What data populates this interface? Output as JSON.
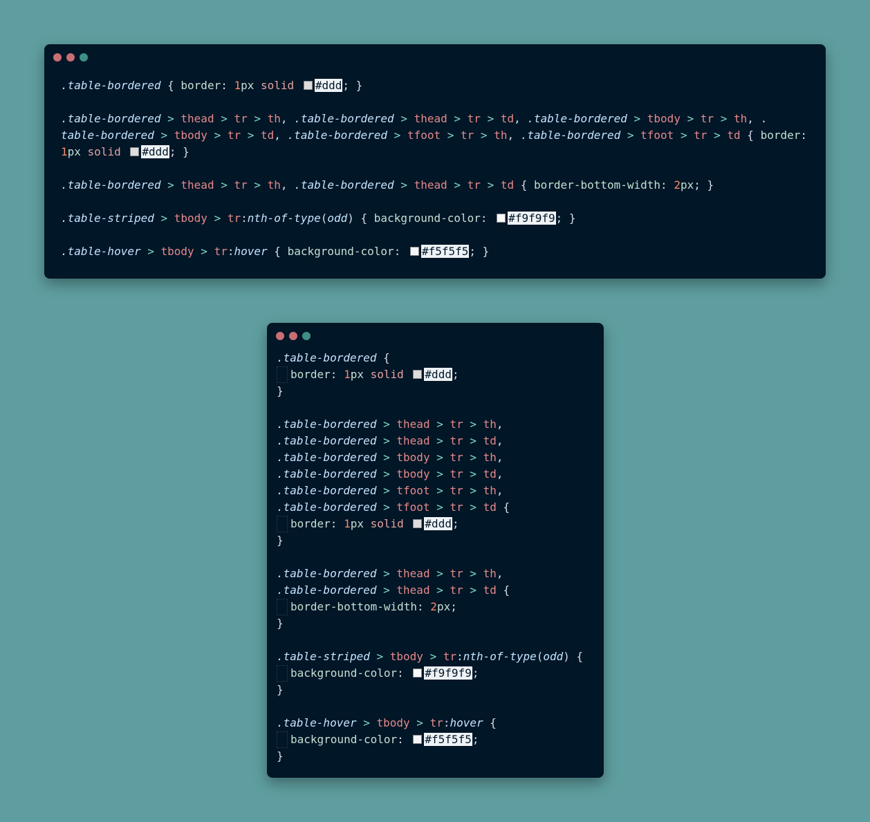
{
  "colors": {
    "background": "#5f9ea0",
    "window": "#011627",
    "dot_close": "#c96f74",
    "dot_min": "#c96f74",
    "dot_max": "#3f8f86"
  },
  "code_compact": {
    "lines": [
      [
        {
          "t": ".table-bordered",
          "c": "cls"
        },
        {
          "t": " { ",
          "c": "punct"
        },
        {
          "t": "border",
          "c": "prop"
        },
        {
          "t": ": ",
          "c": "punct"
        },
        {
          "t": "1",
          "c": "num"
        },
        {
          "t": "px ",
          "c": "prop"
        },
        {
          "t": "solid",
          "c": "kw"
        },
        {
          "t": " ",
          "c": "punct"
        },
        {
          "sw": "#dddddd"
        },
        {
          "t": "#ddd",
          "c": "colorval"
        },
        {
          "t": "; }",
          "c": "punct"
        }
      ],
      [],
      [
        {
          "t": ".table-bordered",
          "c": "cls"
        },
        {
          "t": " > ",
          "c": "op"
        },
        {
          "t": "thead",
          "c": "tag"
        },
        {
          "t": " > ",
          "c": "op"
        },
        {
          "t": "tr",
          "c": "tag"
        },
        {
          "t": " > ",
          "c": "op"
        },
        {
          "t": "th",
          "c": "tag"
        },
        {
          "t": ", ",
          "c": "punct"
        },
        {
          "t": ".table-bordered",
          "c": "cls"
        },
        {
          "t": " > ",
          "c": "op"
        },
        {
          "t": "thead",
          "c": "tag"
        },
        {
          "t": " > ",
          "c": "op"
        },
        {
          "t": "tr",
          "c": "tag"
        },
        {
          "t": " > ",
          "c": "op"
        },
        {
          "t": "td",
          "c": "tag"
        },
        {
          "t": ", ",
          "c": "punct"
        },
        {
          "t": ".table-bordered",
          "c": "cls"
        },
        {
          "t": " > ",
          "c": "op"
        },
        {
          "t": "tbody",
          "c": "tag"
        },
        {
          "t": " > ",
          "c": "op"
        },
        {
          "t": "tr",
          "c": "tag"
        },
        {
          "t": " > ",
          "c": "op"
        },
        {
          "t": "th",
          "c": "tag"
        },
        {
          "t": ", .",
          "c": "punct"
        }
      ],
      [
        {
          "t": "table-bordered",
          "c": "cls"
        },
        {
          "t": " > ",
          "c": "op"
        },
        {
          "t": "tbody",
          "c": "tag"
        },
        {
          "t": " > ",
          "c": "op"
        },
        {
          "t": "tr",
          "c": "tag"
        },
        {
          "t": " > ",
          "c": "op"
        },
        {
          "t": "td",
          "c": "tag"
        },
        {
          "t": ", ",
          "c": "punct"
        },
        {
          "t": ".table-bordered",
          "c": "cls"
        },
        {
          "t": " > ",
          "c": "op"
        },
        {
          "t": "tfoot",
          "c": "tag"
        },
        {
          "t": " > ",
          "c": "op"
        },
        {
          "t": "tr",
          "c": "tag"
        },
        {
          "t": " > ",
          "c": "op"
        },
        {
          "t": "th",
          "c": "tag"
        },
        {
          "t": ", ",
          "c": "punct"
        },
        {
          "t": ".table-bordered",
          "c": "cls"
        },
        {
          "t": " > ",
          "c": "op"
        },
        {
          "t": "tfoot",
          "c": "tag"
        },
        {
          "t": " > ",
          "c": "op"
        },
        {
          "t": "tr",
          "c": "tag"
        },
        {
          "t": " > ",
          "c": "op"
        },
        {
          "t": "td",
          "c": "tag"
        },
        {
          "t": " { ",
          "c": "punct"
        },
        {
          "t": "border",
          "c": "prop"
        },
        {
          "t": ":",
          "c": "punct"
        }
      ],
      [
        {
          "t": "1",
          "c": "num"
        },
        {
          "t": "px ",
          "c": "prop"
        },
        {
          "t": "solid",
          "c": "kw"
        },
        {
          "t": " ",
          "c": "punct"
        },
        {
          "sw": "#dddddd"
        },
        {
          "t": "#ddd",
          "c": "colorval"
        },
        {
          "t": "; }",
          "c": "punct"
        }
      ],
      [],
      [
        {
          "t": ".table-bordered",
          "c": "cls"
        },
        {
          "t": " > ",
          "c": "op"
        },
        {
          "t": "thead",
          "c": "tag"
        },
        {
          "t": " > ",
          "c": "op"
        },
        {
          "t": "tr",
          "c": "tag"
        },
        {
          "t": " > ",
          "c": "op"
        },
        {
          "t": "th",
          "c": "tag"
        },
        {
          "t": ", ",
          "c": "punct"
        },
        {
          "t": ".table-bordered",
          "c": "cls"
        },
        {
          "t": " > ",
          "c": "op"
        },
        {
          "t": "thead",
          "c": "tag"
        },
        {
          "t": " > ",
          "c": "op"
        },
        {
          "t": "tr",
          "c": "tag"
        },
        {
          "t": " > ",
          "c": "op"
        },
        {
          "t": "td",
          "c": "tag"
        },
        {
          "t": " { ",
          "c": "punct"
        },
        {
          "t": "border-bottom-width",
          "c": "prop"
        },
        {
          "t": ": ",
          "c": "punct"
        },
        {
          "t": "2",
          "c": "num"
        },
        {
          "t": "px",
          "c": "prop"
        },
        {
          "t": "; }",
          "c": "punct"
        }
      ],
      [],
      [
        {
          "t": ".table-striped",
          "c": "cls"
        },
        {
          "t": " > ",
          "c": "op"
        },
        {
          "t": "tbody",
          "c": "tag"
        },
        {
          "t": " > ",
          "c": "op"
        },
        {
          "t": "tr",
          "c": "tag"
        },
        {
          "t": ":",
          "c": "punct"
        },
        {
          "t": "nth-of-type",
          "c": "pseudo"
        },
        {
          "t": "(",
          "c": "punct"
        },
        {
          "t": "odd",
          "c": "pseudo"
        },
        {
          "t": ") { ",
          "c": "punct"
        },
        {
          "t": "background-color",
          "c": "prop"
        },
        {
          "t": ": ",
          "c": "punct"
        },
        {
          "sw": "#f9f9f9"
        },
        {
          "t": "#f9f9f9",
          "c": "colorval"
        },
        {
          "t": "; }",
          "c": "punct"
        }
      ],
      [],
      [
        {
          "t": ".table-hover",
          "c": "cls"
        },
        {
          "t": " > ",
          "c": "op"
        },
        {
          "t": "tbody",
          "c": "tag"
        },
        {
          "t": " > ",
          "c": "op"
        },
        {
          "t": "tr",
          "c": "tag"
        },
        {
          "t": ":",
          "c": "punct"
        },
        {
          "t": "hover",
          "c": "pseudo"
        },
        {
          "t": " { ",
          "c": "punct"
        },
        {
          "t": "background-color",
          "c": "prop"
        },
        {
          "t": ": ",
          "c": "punct"
        },
        {
          "sw": "#f5f5f5"
        },
        {
          "t": "#f5f5f5",
          "c": "colorval"
        },
        {
          "t": "; }",
          "c": "punct"
        }
      ]
    ]
  },
  "code_expanded": {
    "lines": [
      [
        {
          "t": ".table-bordered",
          "c": "cls"
        },
        {
          "t": " {",
          "c": "punct"
        }
      ],
      [
        {
          "ind": true
        },
        {
          "t": "border",
          "c": "prop"
        },
        {
          "t": ": ",
          "c": "punct"
        },
        {
          "t": "1",
          "c": "num"
        },
        {
          "t": "px ",
          "c": "prop"
        },
        {
          "t": "solid",
          "c": "kw"
        },
        {
          "t": " ",
          "c": "punct"
        },
        {
          "sw": "#dddddd"
        },
        {
          "t": "#ddd",
          "c": "colorval"
        },
        {
          "t": ";",
          "c": "punct"
        }
      ],
      [
        {
          "t": "}",
          "c": "punct"
        }
      ],
      [],
      [
        {
          "t": ".table-bordered",
          "c": "cls"
        },
        {
          "t": " > ",
          "c": "op"
        },
        {
          "t": "thead",
          "c": "tag"
        },
        {
          "t": " > ",
          "c": "op"
        },
        {
          "t": "tr",
          "c": "tag"
        },
        {
          "t": " > ",
          "c": "op"
        },
        {
          "t": "th",
          "c": "tag"
        },
        {
          "t": ",",
          "c": "punct"
        }
      ],
      [
        {
          "t": ".table-bordered",
          "c": "cls"
        },
        {
          "t": " > ",
          "c": "op"
        },
        {
          "t": "thead",
          "c": "tag"
        },
        {
          "t": " > ",
          "c": "op"
        },
        {
          "t": "tr",
          "c": "tag"
        },
        {
          "t": " > ",
          "c": "op"
        },
        {
          "t": "td",
          "c": "tag"
        },
        {
          "t": ",",
          "c": "punct"
        }
      ],
      [
        {
          "t": ".table-bordered",
          "c": "cls"
        },
        {
          "t": " > ",
          "c": "op"
        },
        {
          "t": "tbody",
          "c": "tag"
        },
        {
          "t": " > ",
          "c": "op"
        },
        {
          "t": "tr",
          "c": "tag"
        },
        {
          "t": " > ",
          "c": "op"
        },
        {
          "t": "th",
          "c": "tag"
        },
        {
          "t": ",",
          "c": "punct"
        }
      ],
      [
        {
          "t": ".table-bordered",
          "c": "cls"
        },
        {
          "t": " > ",
          "c": "op"
        },
        {
          "t": "tbody",
          "c": "tag"
        },
        {
          "t": " > ",
          "c": "op"
        },
        {
          "t": "tr",
          "c": "tag"
        },
        {
          "t": " > ",
          "c": "op"
        },
        {
          "t": "td",
          "c": "tag"
        },
        {
          "t": ",",
          "c": "punct"
        }
      ],
      [
        {
          "t": ".table-bordered",
          "c": "cls"
        },
        {
          "t": " > ",
          "c": "op"
        },
        {
          "t": "tfoot",
          "c": "tag"
        },
        {
          "t": " > ",
          "c": "op"
        },
        {
          "t": "tr",
          "c": "tag"
        },
        {
          "t": " > ",
          "c": "op"
        },
        {
          "t": "th",
          "c": "tag"
        },
        {
          "t": ",",
          "c": "punct"
        }
      ],
      [
        {
          "t": ".table-bordered",
          "c": "cls"
        },
        {
          "t": " > ",
          "c": "op"
        },
        {
          "t": "tfoot",
          "c": "tag"
        },
        {
          "t": " > ",
          "c": "op"
        },
        {
          "t": "tr",
          "c": "tag"
        },
        {
          "t": " > ",
          "c": "op"
        },
        {
          "t": "td",
          "c": "tag"
        },
        {
          "t": " {",
          "c": "punct"
        }
      ],
      [
        {
          "ind": true
        },
        {
          "t": "border",
          "c": "prop"
        },
        {
          "t": ": ",
          "c": "punct"
        },
        {
          "t": "1",
          "c": "num"
        },
        {
          "t": "px ",
          "c": "prop"
        },
        {
          "t": "solid",
          "c": "kw"
        },
        {
          "t": " ",
          "c": "punct"
        },
        {
          "sw": "#dddddd"
        },
        {
          "t": "#ddd",
          "c": "colorval"
        },
        {
          "t": ";",
          "c": "punct"
        }
      ],
      [
        {
          "t": "}",
          "c": "punct"
        }
      ],
      [],
      [
        {
          "t": ".table-bordered",
          "c": "cls"
        },
        {
          "t": " > ",
          "c": "op"
        },
        {
          "t": "thead",
          "c": "tag"
        },
        {
          "t": " > ",
          "c": "op"
        },
        {
          "t": "tr",
          "c": "tag"
        },
        {
          "t": " > ",
          "c": "op"
        },
        {
          "t": "th",
          "c": "tag"
        },
        {
          "t": ",",
          "c": "punct"
        }
      ],
      [
        {
          "t": ".table-bordered",
          "c": "cls"
        },
        {
          "t": " > ",
          "c": "op"
        },
        {
          "t": "thead",
          "c": "tag"
        },
        {
          "t": " > ",
          "c": "op"
        },
        {
          "t": "tr",
          "c": "tag"
        },
        {
          "t": " > ",
          "c": "op"
        },
        {
          "t": "td",
          "c": "tag"
        },
        {
          "t": " {",
          "c": "punct"
        }
      ],
      [
        {
          "ind": true
        },
        {
          "t": "border-bottom-width",
          "c": "prop"
        },
        {
          "t": ": ",
          "c": "punct"
        },
        {
          "t": "2",
          "c": "num"
        },
        {
          "t": "px",
          "c": "prop"
        },
        {
          "t": ";",
          "c": "punct"
        }
      ],
      [
        {
          "t": "}",
          "c": "punct"
        }
      ],
      [],
      [
        {
          "t": ".table-striped",
          "c": "cls"
        },
        {
          "t": " > ",
          "c": "op"
        },
        {
          "t": "tbody",
          "c": "tag"
        },
        {
          "t": " > ",
          "c": "op"
        },
        {
          "t": "tr",
          "c": "tag"
        },
        {
          "t": ":",
          "c": "punct"
        },
        {
          "t": "nth-of-type",
          "c": "pseudo"
        },
        {
          "t": "(",
          "c": "punct"
        },
        {
          "t": "odd",
          "c": "pseudo"
        },
        {
          "t": ") {",
          "c": "punct"
        }
      ],
      [
        {
          "ind": true
        },
        {
          "t": "background-color",
          "c": "prop"
        },
        {
          "t": ": ",
          "c": "punct"
        },
        {
          "sw": "#f9f9f9"
        },
        {
          "t": "#f9f9f9",
          "c": "colorval"
        },
        {
          "t": ";",
          "c": "punct"
        }
      ],
      [
        {
          "t": "}",
          "c": "punct"
        }
      ],
      [],
      [
        {
          "t": ".table-hover",
          "c": "cls"
        },
        {
          "t": " > ",
          "c": "op"
        },
        {
          "t": "tbody",
          "c": "tag"
        },
        {
          "t": " > ",
          "c": "op"
        },
        {
          "t": "tr",
          "c": "tag"
        },
        {
          "t": ":",
          "c": "punct"
        },
        {
          "t": "hover",
          "c": "pseudo"
        },
        {
          "t": " {",
          "c": "punct"
        }
      ],
      [
        {
          "ind": true
        },
        {
          "t": "background-color",
          "c": "prop"
        },
        {
          "t": ": ",
          "c": "punct"
        },
        {
          "sw": "#f5f5f5"
        },
        {
          "t": "#f5f5f5",
          "c": "colorval"
        },
        {
          "t": ";",
          "c": "punct"
        }
      ],
      [
        {
          "t": "}",
          "c": "punct"
        }
      ]
    ]
  }
}
